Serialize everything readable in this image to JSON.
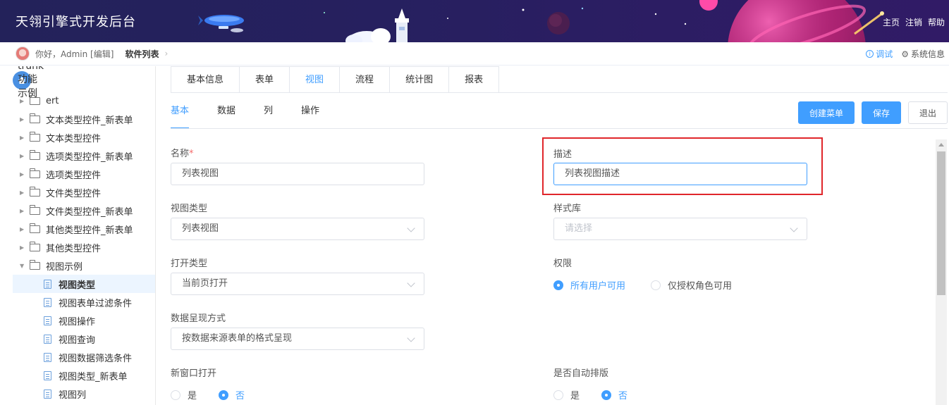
{
  "banner": {
    "title": "天翎引擎式开发后台",
    "links": [
      "主页",
      "注销",
      "帮助"
    ]
  },
  "subheader": {
    "greeting": "你好，Admin [编辑]",
    "breadcrumb": "软件列表",
    "debug": "调试",
    "sysinfo": "系统信息"
  },
  "sidebar": {
    "root": "trunk功能示例",
    "folders": [
      "ert",
      "文本类型控件_新表单",
      "文本类型控件",
      "选项类型控件_新表单",
      "选项类型控件",
      "文件类型控件",
      "文件类型控件_新表单",
      "其他类型控件_新表单",
      "其他类型控件",
      "视图示例"
    ],
    "leaves": [
      "视图类型",
      "视图表单过滤条件",
      "视图操作",
      "视图查询",
      "视图数据筛选条件",
      "视图类型_新表单",
      "视图列"
    ]
  },
  "main_tabs": [
    "基本信息",
    "表单",
    "视图",
    "流程",
    "统计图",
    "报表"
  ],
  "sub_tabs": [
    "基本",
    "数据",
    "列",
    "操作"
  ],
  "buttons": {
    "create_menu": "创建菜单",
    "save": "保存",
    "exit": "退出"
  },
  "form": {
    "name_label": "名称",
    "name_required": "*",
    "name_value": "列表视图",
    "desc_label": "描述",
    "desc_value": "列表视图描述",
    "view_type_label": "视图类型",
    "view_type_value": "列表视图",
    "style_lib_label": "样式库",
    "style_lib_placeholder": "请选择",
    "open_type_label": "打开类型",
    "open_type_value": "当前页打开",
    "permission_label": "权限",
    "permission_options": [
      "所有用户可用",
      "仅授权角色可用"
    ],
    "permission_selected": "所有用户可用",
    "display_label": "数据呈现方式",
    "display_value": "按数据来源表单的格式呈现",
    "new_window_label": "新窗口打开",
    "new_window_options": [
      "是",
      "否"
    ],
    "new_window_selected": "否",
    "auto_layout_label": "是否自动排版",
    "auto_layout_options": [
      "是",
      "否"
    ],
    "auto_layout_selected": "否"
  },
  "colors": {
    "accent": "#409eff",
    "highlight": "#e0262b",
    "banner": "#26205f"
  }
}
